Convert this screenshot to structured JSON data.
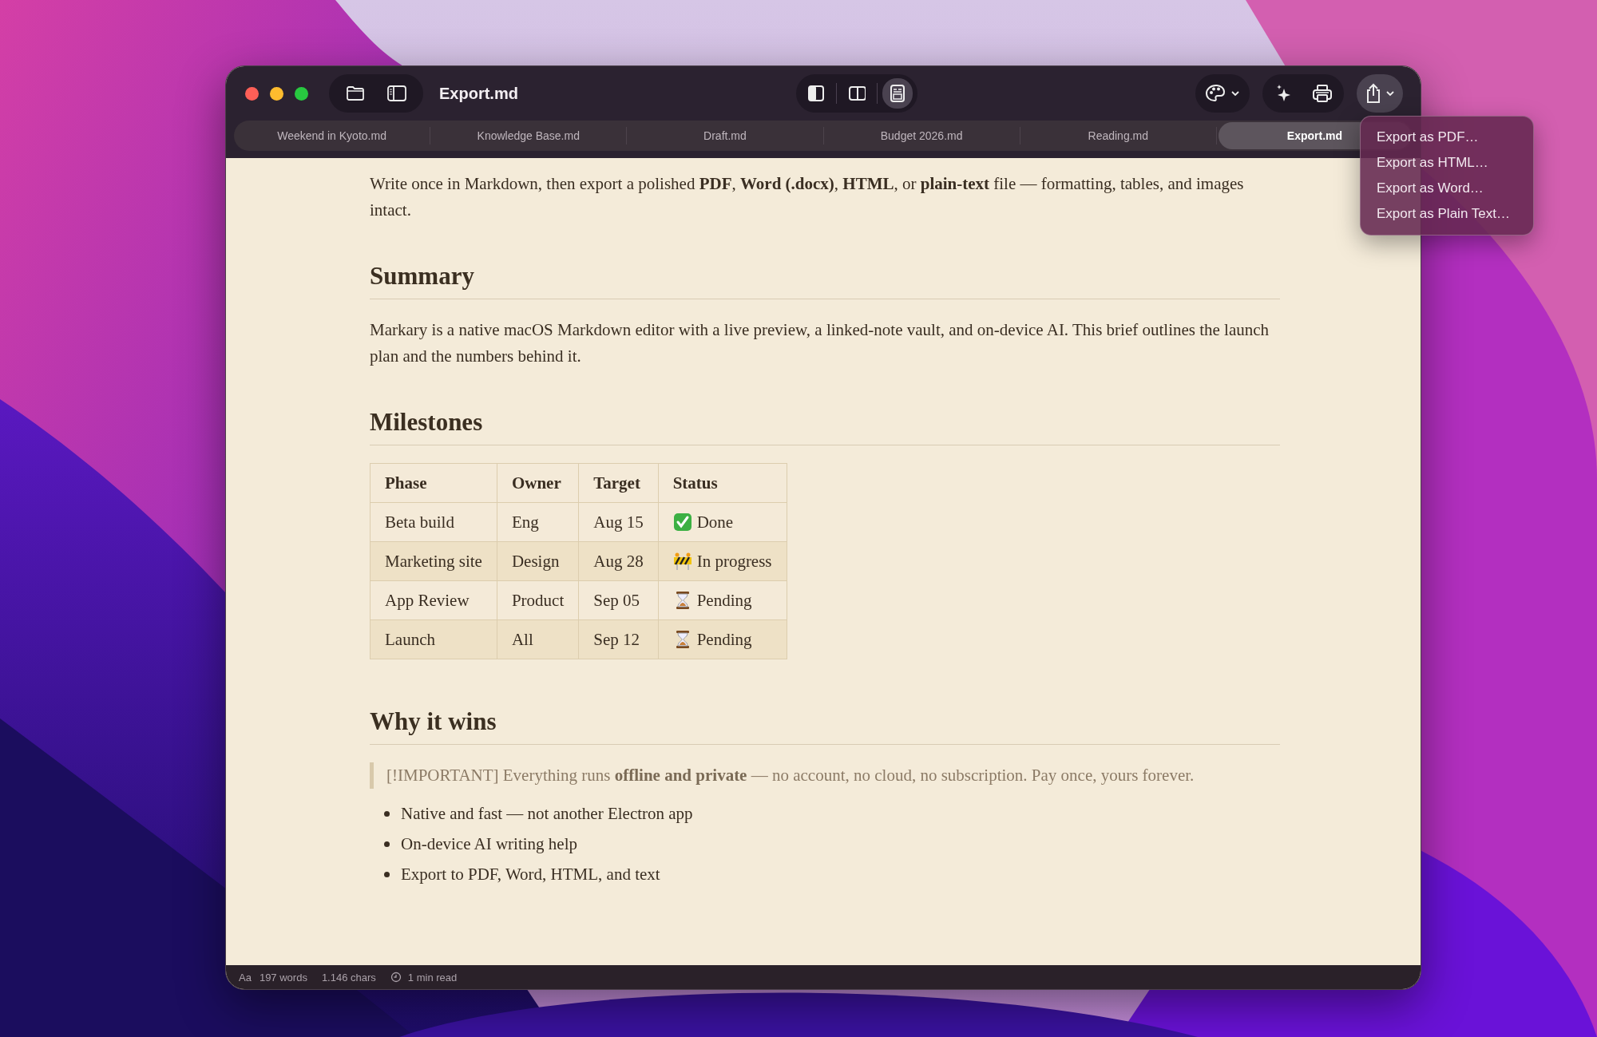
{
  "window": {
    "title": "Export.md"
  },
  "view_modes": [
    {
      "kind": "editor",
      "selected": false
    },
    {
      "kind": "split",
      "selected": false
    },
    {
      "kind": "preview",
      "selected": true
    }
  ],
  "share_button": {
    "pressed": true
  },
  "tabs": [
    {
      "label": "Weekend in Kyoto.md",
      "selected": false
    },
    {
      "label": "Knowledge Base.md",
      "selected": false
    },
    {
      "label": "Draft.md",
      "selected": false
    },
    {
      "label": "Budget 2026.md",
      "selected": false
    },
    {
      "label": "Reading.md",
      "selected": false
    },
    {
      "label": "Export.md",
      "selected": true
    }
  ],
  "export_menu": {
    "items": [
      "Export as PDF…",
      "Export as HTML…",
      "Export as Word…",
      "Export as Plain Text…"
    ]
  },
  "document": [
    {
      "kind": "paragraph",
      "text": "Write once in Markdown, then export a polished **PDF**, **Word (.docx)**, **HTML**, or **plain-text** file — formatting, tables, and images intact."
    },
    {
      "kind": "heading",
      "text": "Summary"
    },
    {
      "kind": "paragraph",
      "text": "Markary is a native macOS Markdown editor with a live preview, a linked-note vault, and on-device AI. This brief outlines the launch plan and the numbers behind it."
    },
    {
      "kind": "heading",
      "text": "Milestones"
    },
    {
      "kind": "table",
      "columns": [
        "Phase",
        "Owner",
        "Target",
        "Status"
      ],
      "rows": [
        {
          "cells": [
            "Beta build",
            "Eng",
            "Aug 15"
          ],
          "status": {
            "kind": "done",
            "text": "Done"
          }
        },
        {
          "cells": [
            "Marketing site",
            "Design",
            "Aug 28"
          ],
          "status": {
            "kind": "in_progress",
            "text": "In progress"
          }
        },
        {
          "cells": [
            "App Review",
            "Product",
            "Sep 05"
          ],
          "status": {
            "kind": "pending",
            "text": "Pending"
          }
        },
        {
          "cells": [
            "Launch",
            "All",
            "Sep 12"
          ],
          "status": {
            "kind": "pending",
            "text": "Pending"
          }
        }
      ]
    },
    {
      "kind": "heading",
      "text": "Why it wins"
    },
    {
      "kind": "blockquote",
      "text": "[!IMPORTANT] Everything runs **offline and private** — no account, no cloud, no subscription. Pay once, yours forever."
    },
    {
      "kind": "list",
      "items": [
        "Native and fast — not another Electron app",
        "On-device AI writing help",
        "Export to PDF, Word, HTML, and text"
      ]
    }
  ],
  "status_bar": {
    "font_label": "Aa",
    "words": "197 words",
    "chars": "1.146 chars",
    "read_time": "1 min read"
  }
}
